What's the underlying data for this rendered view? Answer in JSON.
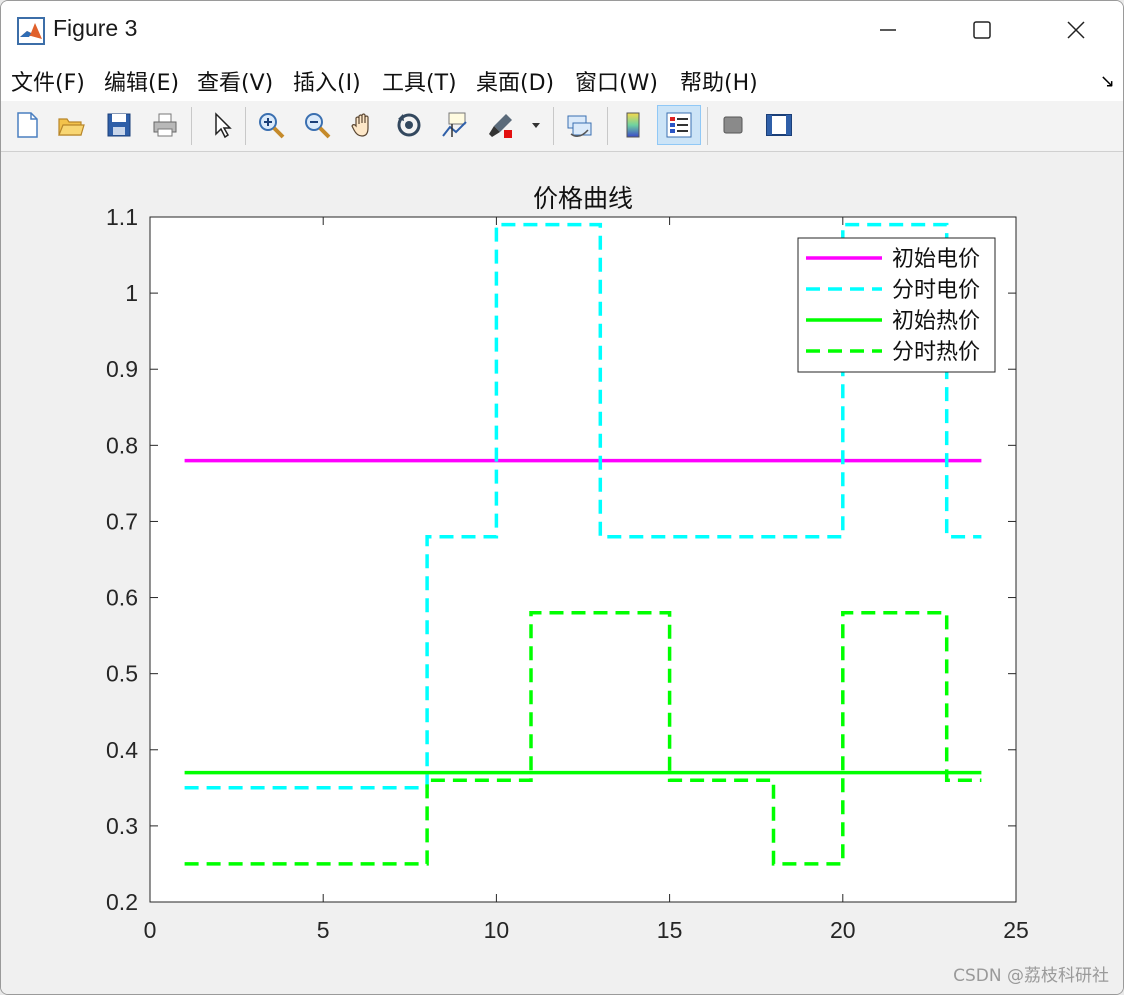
{
  "window": {
    "title": "Figure 3",
    "buttons": [
      "minimize",
      "maximize",
      "close"
    ]
  },
  "menu": {
    "items": [
      "文件(F)",
      "编辑(E)",
      "查看(V)",
      "插入(I)",
      "工具(T)",
      "桌面(D)",
      "窗口(W)",
      "帮助(H)"
    ],
    "dock_icon": "↘"
  },
  "toolbar": {
    "icons": [
      "new-figure-icon",
      "open-file-icon",
      "save-icon",
      "print-icon",
      "select-pointer-icon",
      "zoom-in-icon",
      "zoom-out-icon",
      "pan-hand-icon",
      "rotate-3d-icon",
      "data-cursor-icon",
      "brush-icon",
      "link-plot-icon",
      "colorbar-icon",
      "legend-icon",
      "hide-plot-tools-icon",
      "show-plot-tools-icon"
    ],
    "active": "legend-icon"
  },
  "chart_data": {
    "type": "line",
    "title": "价格曲线",
    "xlim": [
      0,
      25
    ],
    "ylim": [
      0.2,
      1.1
    ],
    "xticks": [
      "0",
      "5",
      "10",
      "15",
      "20",
      "25"
    ],
    "yticks": [
      "0.2",
      "0.3",
      "0.4",
      "0.5",
      "0.6",
      "0.7",
      "0.8",
      "0.9",
      "1",
      "1.1"
    ],
    "grid": false,
    "legend_position": "top-right",
    "series": [
      {
        "name": "初始电价",
        "color": "#ff00ff",
        "style": "solid",
        "points": [
          [
            1,
            0.78
          ],
          [
            24,
            0.78
          ]
        ]
      },
      {
        "name": "分时电价",
        "color": "#00ffff",
        "style": "dashed",
        "points": [
          [
            1,
            0.35
          ],
          [
            8,
            0.35
          ],
          [
            8,
            0.68
          ],
          [
            10,
            0.68
          ],
          [
            10,
            1.09
          ],
          [
            13,
            1.09
          ],
          [
            13,
            0.68
          ],
          [
            20,
            0.68
          ],
          [
            20,
            1.09
          ],
          [
            23,
            1.09
          ],
          [
            23,
            0.68
          ],
          [
            24,
            0.68
          ]
        ]
      },
      {
        "name": "初始热价",
        "color": "#00ff00",
        "style": "solid",
        "points": [
          [
            1,
            0.37
          ],
          [
            24,
            0.37
          ]
        ]
      },
      {
        "name": "分时热价",
        "color": "#00ff00",
        "style": "dashed",
        "points": [
          [
            1,
            0.25
          ],
          [
            8,
            0.25
          ],
          [
            8,
            0.36
          ],
          [
            11,
            0.36
          ],
          [
            11,
            0.58
          ],
          [
            15,
            0.58
          ],
          [
            15,
            0.36
          ],
          [
            18,
            0.36
          ],
          [
            18,
            0.25
          ],
          [
            20,
            0.25
          ],
          [
            20,
            0.58
          ],
          [
            23,
            0.58
          ],
          [
            23,
            0.36
          ],
          [
            24,
            0.36
          ]
        ]
      }
    ]
  },
  "watermark": "CSDN @荔枝科研社"
}
